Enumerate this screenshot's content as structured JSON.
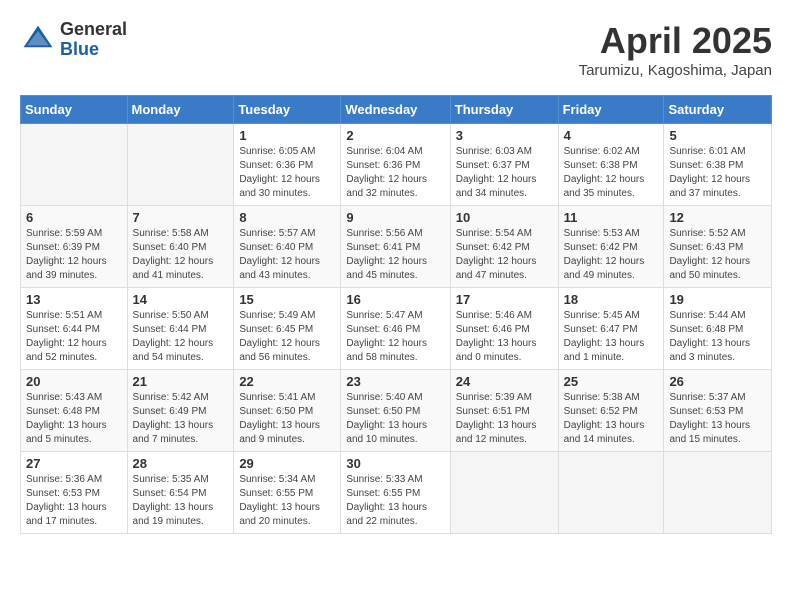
{
  "header": {
    "logo_general": "General",
    "logo_blue": "Blue",
    "title": "April 2025",
    "location": "Tarumizu, Kagoshima, Japan"
  },
  "weekdays": [
    "Sunday",
    "Monday",
    "Tuesday",
    "Wednesday",
    "Thursday",
    "Friday",
    "Saturday"
  ],
  "weeks": [
    [
      {
        "day": "",
        "info": ""
      },
      {
        "day": "",
        "info": ""
      },
      {
        "day": "1",
        "info": "Sunrise: 6:05 AM\nSunset: 6:36 PM\nDaylight: 12 hours\nand 30 minutes."
      },
      {
        "day": "2",
        "info": "Sunrise: 6:04 AM\nSunset: 6:36 PM\nDaylight: 12 hours\nand 32 minutes."
      },
      {
        "day": "3",
        "info": "Sunrise: 6:03 AM\nSunset: 6:37 PM\nDaylight: 12 hours\nand 34 minutes."
      },
      {
        "day": "4",
        "info": "Sunrise: 6:02 AM\nSunset: 6:38 PM\nDaylight: 12 hours\nand 35 minutes."
      },
      {
        "day": "5",
        "info": "Sunrise: 6:01 AM\nSunset: 6:38 PM\nDaylight: 12 hours\nand 37 minutes."
      }
    ],
    [
      {
        "day": "6",
        "info": "Sunrise: 5:59 AM\nSunset: 6:39 PM\nDaylight: 12 hours\nand 39 minutes."
      },
      {
        "day": "7",
        "info": "Sunrise: 5:58 AM\nSunset: 6:40 PM\nDaylight: 12 hours\nand 41 minutes."
      },
      {
        "day": "8",
        "info": "Sunrise: 5:57 AM\nSunset: 6:40 PM\nDaylight: 12 hours\nand 43 minutes."
      },
      {
        "day": "9",
        "info": "Sunrise: 5:56 AM\nSunset: 6:41 PM\nDaylight: 12 hours\nand 45 minutes."
      },
      {
        "day": "10",
        "info": "Sunrise: 5:54 AM\nSunset: 6:42 PM\nDaylight: 12 hours\nand 47 minutes."
      },
      {
        "day": "11",
        "info": "Sunrise: 5:53 AM\nSunset: 6:42 PM\nDaylight: 12 hours\nand 49 minutes."
      },
      {
        "day": "12",
        "info": "Sunrise: 5:52 AM\nSunset: 6:43 PM\nDaylight: 12 hours\nand 50 minutes."
      }
    ],
    [
      {
        "day": "13",
        "info": "Sunrise: 5:51 AM\nSunset: 6:44 PM\nDaylight: 12 hours\nand 52 minutes."
      },
      {
        "day": "14",
        "info": "Sunrise: 5:50 AM\nSunset: 6:44 PM\nDaylight: 12 hours\nand 54 minutes."
      },
      {
        "day": "15",
        "info": "Sunrise: 5:49 AM\nSunset: 6:45 PM\nDaylight: 12 hours\nand 56 minutes."
      },
      {
        "day": "16",
        "info": "Sunrise: 5:47 AM\nSunset: 6:46 PM\nDaylight: 12 hours\nand 58 minutes."
      },
      {
        "day": "17",
        "info": "Sunrise: 5:46 AM\nSunset: 6:46 PM\nDaylight: 13 hours\nand 0 minutes."
      },
      {
        "day": "18",
        "info": "Sunrise: 5:45 AM\nSunset: 6:47 PM\nDaylight: 13 hours\nand 1 minute."
      },
      {
        "day": "19",
        "info": "Sunrise: 5:44 AM\nSunset: 6:48 PM\nDaylight: 13 hours\nand 3 minutes."
      }
    ],
    [
      {
        "day": "20",
        "info": "Sunrise: 5:43 AM\nSunset: 6:48 PM\nDaylight: 13 hours\nand 5 minutes."
      },
      {
        "day": "21",
        "info": "Sunrise: 5:42 AM\nSunset: 6:49 PM\nDaylight: 13 hours\nand 7 minutes."
      },
      {
        "day": "22",
        "info": "Sunrise: 5:41 AM\nSunset: 6:50 PM\nDaylight: 13 hours\nand 9 minutes."
      },
      {
        "day": "23",
        "info": "Sunrise: 5:40 AM\nSunset: 6:50 PM\nDaylight: 13 hours\nand 10 minutes."
      },
      {
        "day": "24",
        "info": "Sunrise: 5:39 AM\nSunset: 6:51 PM\nDaylight: 13 hours\nand 12 minutes."
      },
      {
        "day": "25",
        "info": "Sunrise: 5:38 AM\nSunset: 6:52 PM\nDaylight: 13 hours\nand 14 minutes."
      },
      {
        "day": "26",
        "info": "Sunrise: 5:37 AM\nSunset: 6:53 PM\nDaylight: 13 hours\nand 15 minutes."
      }
    ],
    [
      {
        "day": "27",
        "info": "Sunrise: 5:36 AM\nSunset: 6:53 PM\nDaylight: 13 hours\nand 17 minutes."
      },
      {
        "day": "28",
        "info": "Sunrise: 5:35 AM\nSunset: 6:54 PM\nDaylight: 13 hours\nand 19 minutes."
      },
      {
        "day": "29",
        "info": "Sunrise: 5:34 AM\nSunset: 6:55 PM\nDaylight: 13 hours\nand 20 minutes."
      },
      {
        "day": "30",
        "info": "Sunrise: 5:33 AM\nSunset: 6:55 PM\nDaylight: 13 hours\nand 22 minutes."
      },
      {
        "day": "",
        "info": ""
      },
      {
        "day": "",
        "info": ""
      },
      {
        "day": "",
        "info": ""
      }
    ]
  ]
}
